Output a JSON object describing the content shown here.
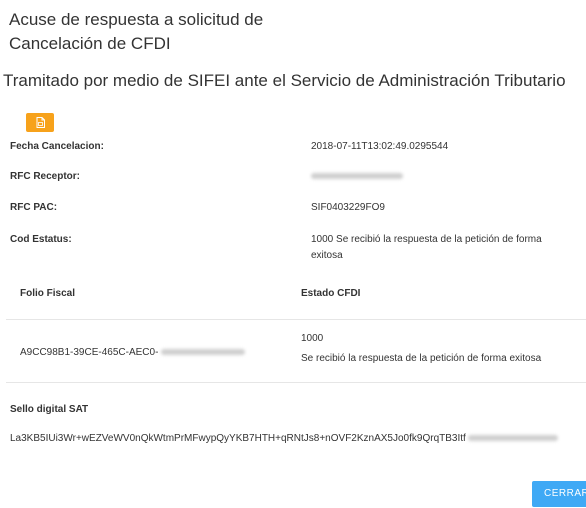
{
  "header": {
    "title_line1": "Acuse de respuesta a solicitud de",
    "title_line2": "Cancelación de CFDI",
    "subtitle": "Tramitado por medio de SIFEI ante el Servicio de Administración Tributario"
  },
  "pdf_button": {
    "icon": "pdf-icon"
  },
  "details": {
    "fecha_label": "Fecha Cancelacion:",
    "fecha_value": "2018-07-11T13:02:49.0295544",
    "rfc_receptor_label": "RFC Receptor:",
    "rfc_pac_label": "RFC PAC:",
    "rfc_pac_value": "SIF0403229FO9",
    "cod_estatus_label": "Cod Estatus:",
    "cod_estatus_value_line1": "1000 Se recibió la respuesta de la petición de forma",
    "cod_estatus_value_line2": "exitosa"
  },
  "table": {
    "headers": [
      "Folio Fiscal",
      "Estado CFDI"
    ],
    "row": {
      "folio": "A9CC98B1-39CE-465C-AEC0-",
      "estado_code": "1000",
      "estado_text": "Se recibió la respuesta de la petición de forma exitosa"
    }
  },
  "sello": {
    "label": "Sello digital SAT",
    "value": "La3KB5IUi3Wr+wEZVeWV0nQkWtmPrMFwypQyYKB7HTH+qRNtJs8+nOVF2KznAX5Jo0fk9QrqTB3Itf"
  },
  "footer": {
    "close_label": "CERRAR"
  },
  "colors": {
    "pdf_button": "#f7a21b",
    "close_button": "#3fa9f5"
  }
}
